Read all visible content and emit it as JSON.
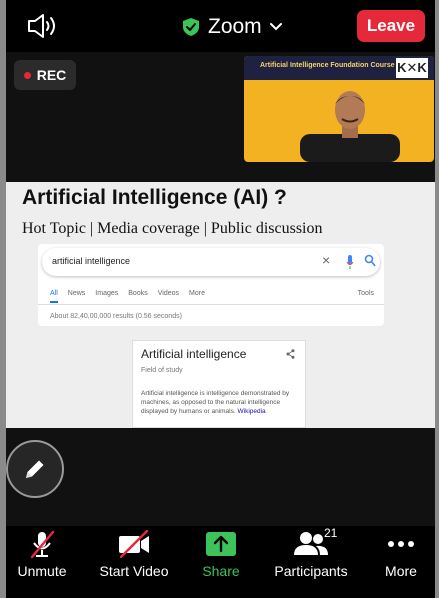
{
  "topbar": {
    "title": "Zoom",
    "leave_label": "Leave"
  },
  "recording": {
    "label": "REC"
  },
  "thumbnail": {
    "course_title": "Artificial Intelligence Foundation Course",
    "logo_text": "K✕K"
  },
  "slide": {
    "heading": "Artificial Intelligence (AI) ?",
    "subheading": "Hot Topic | Media coverage | Public discussion",
    "search": {
      "query": "artificial intelligence",
      "tabs": [
        "All",
        "News",
        "Images",
        "Books",
        "Videos",
        "More"
      ],
      "tools": "Tools",
      "results_count": "About 82,40,00,000 results (0.56 seconds)"
    },
    "knowledge_panel": {
      "title": "Artificial intelligence",
      "subtitle": "Field of study",
      "description": "Artificial intelligence is intelligence demonstrated by machines, as opposed to the natural intelligence displayed by humans or animals.",
      "link": "Wikipedia"
    }
  },
  "toolbar": {
    "unmute": "Unmute",
    "start_video": "Start Video",
    "share": "Share",
    "participants": "Participants",
    "participants_count": "21",
    "more": "More"
  },
  "colors": {
    "leave": "#e5293a",
    "share": "#3cc35a",
    "secure": "#3cc35a",
    "thumb_bg": "#f3b221"
  }
}
